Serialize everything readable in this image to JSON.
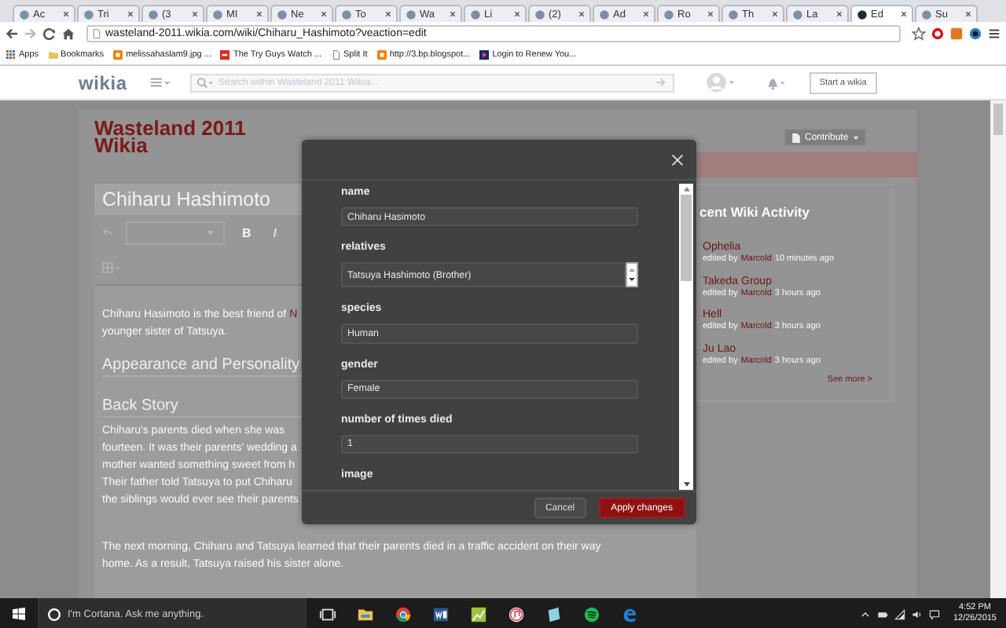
{
  "browser": {
    "tabs": [
      {
        "label": "Ac",
        "selected": false
      },
      {
        "label": "Tri",
        "selected": false
      },
      {
        "label": "(3",
        "selected": false
      },
      {
        "label": "MI",
        "selected": false
      },
      {
        "label": "Ne",
        "selected": false
      },
      {
        "label": "To",
        "selected": false
      },
      {
        "label": "Wa",
        "selected": false
      },
      {
        "label": "Li",
        "selected": false
      },
      {
        "label": "(2)",
        "selected": false
      },
      {
        "label": "Ad",
        "selected": false
      },
      {
        "label": "Ro",
        "selected": false
      },
      {
        "label": "Th",
        "selected": false
      },
      {
        "label": "La",
        "selected": false
      },
      {
        "label": "Ed",
        "selected": true
      },
      {
        "label": "Su",
        "selected": false
      }
    ],
    "address": "wasteland-2011.wikia.com/wiki/Chiharu_Hashimoto?veaction=edit",
    "bookmarks": [
      {
        "label": "Apps",
        "kind": "apps"
      },
      {
        "label": "Bookmarks",
        "kind": "folder"
      },
      {
        "label": "melissahaslam9.jpg ...",
        "kind": "blogger"
      },
      {
        "label": "The Try Guys Watch ...",
        "kind": "feed"
      },
      {
        "label": "Split It",
        "kind": "page"
      },
      {
        "label": "http://3.bp.blogspot...",
        "kind": "blogger"
      },
      {
        "label": "Login to Renew You...",
        "kind": "video"
      }
    ]
  },
  "site_header": {
    "logo": "wikia",
    "search": {
      "placeholder": "Search within Wasteland 2011 Wikia..."
    },
    "start_button": "Start a wikia"
  },
  "page": {
    "wiki_title": [
      "Wasteland 2011",
      "Wikia"
    ],
    "article": {
      "title": "Chiharu Hashimoto",
      "toolbar": {
        "bold": "B",
        "italic": "I"
      },
      "intro_lines": [
        "Chiharu Hasimoto is the best friend of",
        "younger sister of Tatsuya."
      ],
      "intro_link": "N",
      "sections": [
        {
          "heading": "Appearance and Personality"
        },
        {
          "heading": "Back Story",
          "lines": [
            "Chiharu's parents died when she was",
            "fourteen. It was their parents' wedding a",
            "mother wanted something sweet from h",
            "Their father told Tatsuya to put Chiharu",
            "the siblings would ever see their parents"
          ]
        }
      ],
      "closing_lines": [
        "The next morning, Chiharu and Tatsuya learned that their parents died in a traffic accident on their way",
        "home. As a result, Tatsuya raised his sister alone."
      ]
    },
    "sidebar": {
      "contribute": "Contribute",
      "heading": "cent Wiki Activity",
      "items": [
        {
          "title": "Ophelia",
          "prefix": "edited by",
          "user": "Marcold",
          "time": "10 minutes ago"
        },
        {
          "title": "Takeda Group",
          "prefix": "edited by",
          "user": "Marcold",
          "time": "3 hours ago"
        },
        {
          "title": "Hell",
          "prefix": "edited by",
          "user": "Marcold",
          "time": "3 hours ago"
        },
        {
          "title": "Ju Lao",
          "prefix": "edited by",
          "user": "Marcold",
          "time": "3 hours ago"
        }
      ],
      "see_more": "See more >"
    }
  },
  "dialog": {
    "fields": [
      {
        "label": "name",
        "value": "Chiharu Hasimoto",
        "kind": "text"
      },
      {
        "label": "relatives",
        "value": "Tatsuya Hashimoto (Brother)",
        "kind": "spinner"
      },
      {
        "label": "species",
        "value": "Human",
        "kind": "text"
      },
      {
        "label": "gender",
        "value": "Female",
        "kind": "text"
      },
      {
        "label": "number of times died",
        "value": "1",
        "kind": "text"
      }
    ],
    "next_label": "image",
    "buttons": [
      {
        "label": "Cancel",
        "kind": "secondary"
      },
      {
        "label": "Apply changes",
        "kind": "primary"
      }
    ]
  },
  "taskbar": {
    "search_placeholder": "I'm Cortana. Ask me anything.",
    "apps": [
      {
        "kind": "taskview"
      },
      {
        "kind": "explorer"
      },
      {
        "kind": "chrome"
      },
      {
        "kind": "word"
      },
      {
        "kind": "sheet"
      },
      {
        "kind": "music"
      },
      {
        "kind": "notes"
      },
      {
        "kind": "spotify"
      },
      {
        "kind": "edge"
      }
    ],
    "time": "4:52 PM",
    "date": "12/26/2015"
  }
}
